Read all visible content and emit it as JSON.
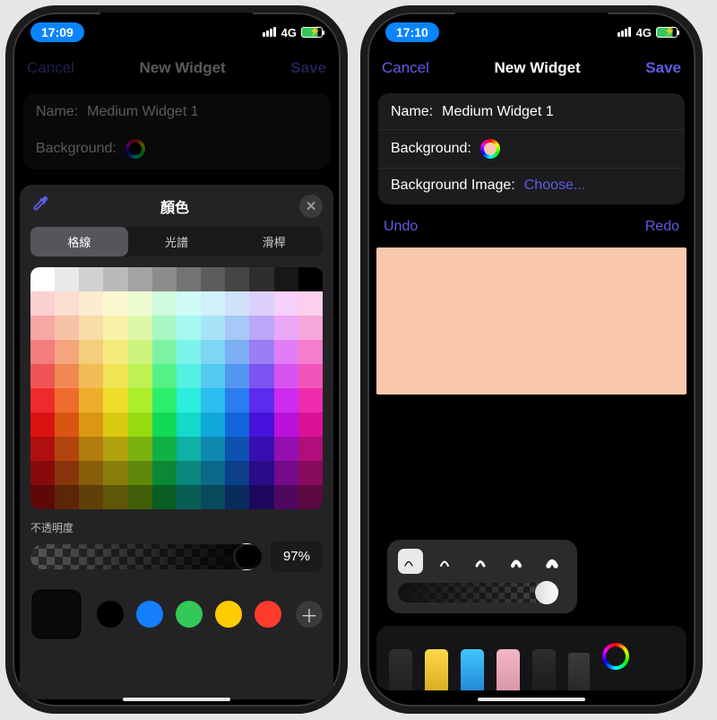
{
  "left": {
    "status": {
      "time": "17:09",
      "net": "4G"
    },
    "nav": {
      "cancel": "Cancel",
      "title": "New Widget",
      "save": "Save"
    },
    "form": {
      "name_label": "Name:",
      "name_value": "Medium Widget 1",
      "bg_label": "Background:",
      "bg_color": "#000000"
    },
    "picker": {
      "title": "顏色",
      "tabs": [
        "格線",
        "光譜",
        "滑桿"
      ],
      "tab_active": 0,
      "opacity_label": "不透明度",
      "opacity_value": "97%",
      "preset_colors": [
        "#000000",
        "#147efb",
        "#34c759",
        "#ffcc00",
        "#ff3b30"
      ],
      "current": "#0a0a0a"
    }
  },
  "right": {
    "status": {
      "time": "17:10",
      "net": "4G"
    },
    "nav": {
      "cancel": "Cancel",
      "title": "New Widget",
      "save": "Save"
    },
    "form": {
      "name_label": "Name:",
      "name_value": "Medium Widget 1",
      "bg_label": "Background:",
      "bg_color": "#fac8ac",
      "bgimg_label": "Background Image:",
      "bgimg_action": "Choose..."
    },
    "actions": {
      "undo": "Undo",
      "redo": "Redo"
    },
    "canvas_color": "#fac8ac",
    "tools": [
      "pen",
      "highlighter",
      "pencil",
      "eraser",
      "crayon",
      "ruler",
      "color"
    ]
  }
}
